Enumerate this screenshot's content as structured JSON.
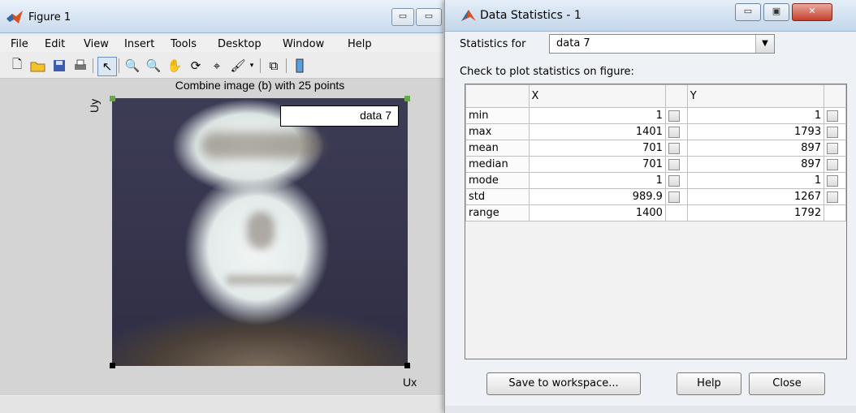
{
  "figure": {
    "title": "Figure 1",
    "menu": [
      "File",
      "Edit",
      "View",
      "Insert",
      "Tools",
      "Desktop",
      "Window",
      "Help"
    ],
    "toolbar_icons": [
      "new-file-icon",
      "open-folder-icon",
      "save-icon",
      "print-icon",
      "pointer-icon",
      "zoom-in-icon",
      "zoom-out-icon",
      "pan-hand-icon",
      "rotate-3d-icon",
      "data-cursor-icon",
      "brush-icon",
      "dropdown-arrow-icon",
      "link-plot-icon",
      "colorbar-icon"
    ],
    "plot_title": "Combine image (b) with 25 points",
    "legend_label": "data 7",
    "ylabel": "Uy",
    "xlabel": "Ux"
  },
  "dialog": {
    "title": "Data Statistics - 1",
    "stats_for_label": "Statistics for",
    "stats_for_value": "data 7",
    "check_label": "Check to plot statistics on figure:",
    "columns": [
      "X",
      "Y"
    ],
    "rows": [
      {
        "label": "min",
        "x": "1",
        "y": "1",
        "checkbox": true
      },
      {
        "label": "max",
        "x": "1401",
        "y": "1793",
        "checkbox": true
      },
      {
        "label": "mean",
        "x": "701",
        "y": "897",
        "checkbox": true
      },
      {
        "label": "median",
        "x": "701",
        "y": "897",
        "checkbox": true
      },
      {
        "label": "mode",
        "x": "1",
        "y": "1",
        "checkbox": true
      },
      {
        "label": "std",
        "x": "989.9",
        "y": "1267",
        "checkbox": true
      },
      {
        "label": "range",
        "x": "1400",
        "y": "1792",
        "checkbox": false
      }
    ],
    "buttons": {
      "save": "Save to workspace...",
      "help": "Help",
      "close": "Close"
    }
  }
}
